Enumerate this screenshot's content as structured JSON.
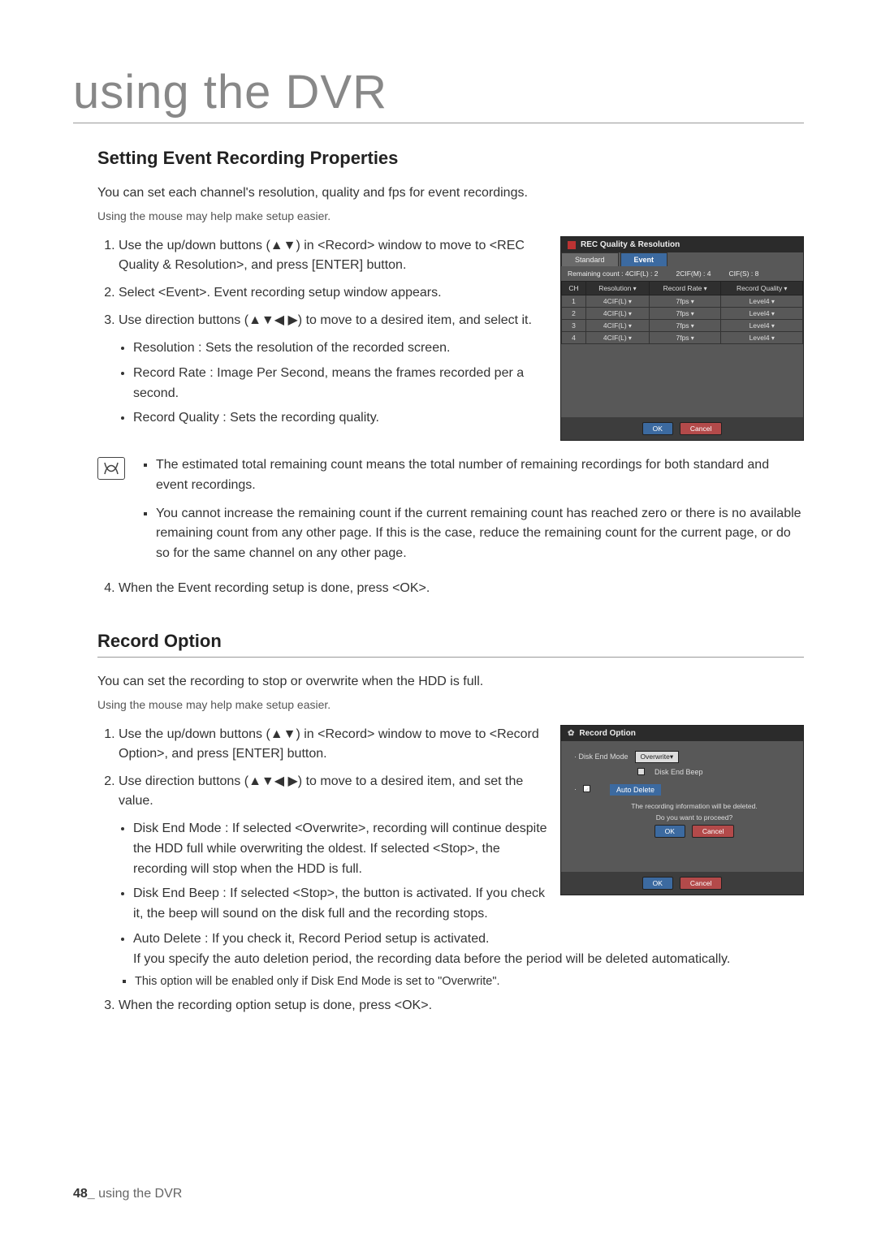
{
  "page_title": "using the DVR",
  "footer": {
    "page_num": "48_",
    "text": "using the DVR"
  },
  "sec1": {
    "heading": "Setting Event Recording Properties",
    "intro1": "You can set each channel's resolution, quality and fps for event recordings.",
    "intro2": "Using the mouse may help make setup easier.",
    "step1": "Use the up/down buttons (▲▼) in <Record> window to move to <REC Quality & Resolution>, and press [ENTER] button.",
    "step2": "Select <Event>. Event recording setup window appears.",
    "step3": "Use direction buttons (▲▼◀ ▶) to move to a desired item, and select it.",
    "b1": "Resolution : Sets the resolution of the recorded screen.",
    "b2": "Record Rate : Image Per Second, means the frames recorded per a second.",
    "b3": "Record Quality : Sets the recording quality.",
    "note1": "The estimated total remaining count means the total number of remaining recordings for both standard and event recordings.",
    "note2": "You cannot increase the remaining count if the current remaining count has reached zero or there is no available remaining count from any other page. If this is the case, reduce the remaining count for the current page, or do so for the same channel on any other page.",
    "step4": "When the Event recording setup is done, press <OK>."
  },
  "rec_panel": {
    "title": "REC Quality & Resolution",
    "tab_standard": "Standard",
    "tab_event": "Event",
    "counts": {
      "remaining": "Remaining count : 4CIF(L) : 2",
      "mid": "2CIF(M) : 4",
      "small": "CIF(S) : 8"
    },
    "headers": {
      "ch": "CH",
      "res": "Resolution",
      "rate": "Record Rate",
      "qual": "Record Quality"
    },
    "rows": [
      {
        "ch": "1",
        "res": "4CIF(L)",
        "rate": "7fps",
        "qual": "Level4"
      },
      {
        "ch": "2",
        "res": "4CIF(L)",
        "rate": "7fps",
        "qual": "Level4"
      },
      {
        "ch": "3",
        "res": "4CIF(L)",
        "rate": "7fps",
        "qual": "Level4"
      },
      {
        "ch": "4",
        "res": "4CIF(L)",
        "rate": "7fps",
        "qual": "Level4"
      }
    ],
    "ok": "OK",
    "cancel": "Cancel"
  },
  "sec2": {
    "heading": "Record Option",
    "intro1": "You can set the recording to stop or overwrite when the HDD is full.",
    "intro2": "Using the mouse may help make setup easier.",
    "step1": "Use the up/down buttons (▲▼) in <Record> window to move to <Record Option>, and press [ENTER] button.",
    "step2": "Use direction buttons (▲▼◀ ▶) to move to a desired item, and set the value.",
    "b1": "Disk End Mode : If selected <Overwrite>, recording will continue despite the HDD full while overwriting the oldest. If selected <Stop>, the recording will stop when the HDD is full.",
    "b2": "Disk End Beep : If selected <Stop>, the button is activated. If you check it, the beep will sound on the disk full and the recording stops.",
    "b3a": "Auto Delete : If you check it, Record Period setup is activated.",
    "b3b": "If you specify the auto deletion period, the recording data before the period will be deleted automatically.",
    "subnote": "This option will be enabled only if Disk End Mode is set to \"Overwrite\".",
    "step3": "When the recording option setup is done, press <OK>."
  },
  "ro_panel": {
    "title": "Record Option",
    "disk_end_mode_label": "· Disk End Mode",
    "disk_end_mode_value": "Overwrite",
    "disk_end_beep_label": "Disk End Beep",
    "auto_delete_label": "Auto Delete",
    "dialog_msg1": "The recording information will be deleted.",
    "dialog_msg2": "Do you want to proceed?",
    "ok": "OK",
    "cancel": "Cancel"
  }
}
